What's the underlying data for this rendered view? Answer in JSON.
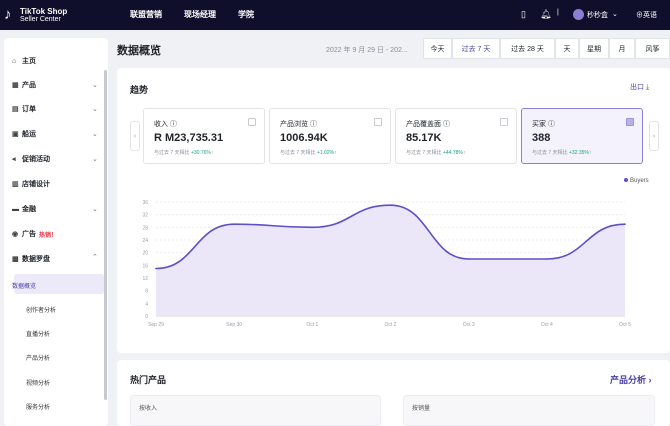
{
  "header": {
    "brand_line1": "TikTok Shop",
    "brand_line2": "Seller Center",
    "nav": [
      "联盟营销",
      "现场经理",
      "学院"
    ],
    "username": "秒秒盒",
    "language": "英语"
  },
  "sidebar": {
    "items": [
      {
        "label": "主页",
        "icon": "home-icon"
      },
      {
        "label": "产品",
        "icon": "product-icon"
      },
      {
        "label": "订单",
        "icon": "order-icon"
      },
      {
        "label": "船运",
        "icon": "shipping-icon"
      },
      {
        "label": "促销活动",
        "icon": "megaphone-icon"
      },
      {
        "label": "店铺设计",
        "icon": "store-icon"
      },
      {
        "label": "金融",
        "icon": "finance-icon"
      },
      {
        "label": "广告",
        "icon": "ads-icon",
        "badge": "热销！"
      },
      {
        "label": "数据罗盘",
        "icon": "compass-icon"
      }
    ],
    "sub_items": [
      "数据概览",
      "创作者分析",
      "直播分析",
      "产品分析",
      "视频分析",
      "服务分析"
    ]
  },
  "page": {
    "title": "数据概览",
    "date_range": "2022 年 9 月 29 日 - 202...",
    "ranges": [
      "今天",
      "过去 7 天",
      "过去 28 天",
      "天",
      "星期",
      "月",
      "风筝"
    ],
    "active_range": "过去 7 天"
  },
  "trend": {
    "title": "趋势",
    "export_label": "出口",
    "metrics": [
      {
        "label": "收入",
        "value": "R M23,735.31",
        "compare": "与过去 7 天相比",
        "change": "+30.76%",
        "selected": false
      },
      {
        "label": "产品浏览",
        "value": "1006.94K",
        "compare": "与过去 7 天相比",
        "change": "+1.02%",
        "selected": false
      },
      {
        "label": "产品覆盖面",
        "value": "85.17K",
        "compare": "与过去 7 天相比",
        "change": "+44.78%",
        "selected": false
      },
      {
        "label": "买家",
        "value": "388",
        "compare": "与过去 7 天相比",
        "change": "+32.35%",
        "selected": true
      }
    ]
  },
  "chart_data": {
    "type": "area",
    "categories": [
      "Sep 29",
      "Sep 30",
      "Oct 1",
      "Oct 2",
      "Oct 3",
      "Oct 4",
      "Oct 5"
    ],
    "series": [
      {
        "name": "Buyers",
        "values": [
          15,
          29,
          28,
          35,
          18,
          18,
          29
        ]
      }
    ],
    "yticks": [
      0,
      4,
      8,
      12,
      16,
      20,
      24,
      28,
      32,
      36
    ],
    "ylim": [
      0,
      36
    ],
    "grid": true,
    "legend": "top-right",
    "color": "#5c4fc7",
    "fill": "#e7e3f8"
  },
  "hot": {
    "title": "热门产品",
    "link": "产品分析",
    "cards": [
      "按收入",
      "按销量"
    ]
  }
}
